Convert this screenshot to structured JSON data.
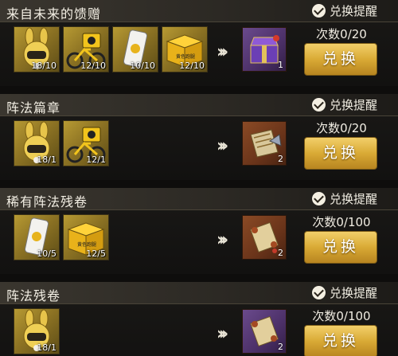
{
  "sections": [
    {
      "title": "来自未来的馈赠",
      "remind": "兑换提醒",
      "times": "次数0/20",
      "button": "兑换",
      "items": [
        {
          "icon": "rabbit-helmet-icon",
          "count": "18/10"
        },
        {
          "icon": "bicycle-icon",
          "count": "12/10"
        },
        {
          "icon": "phone-icon",
          "count": "10/10"
        },
        {
          "icon": "gold-box-icon",
          "count": "12/10"
        }
      ],
      "reward": {
        "icon": "treasure-chest-icon",
        "count": "1"
      }
    },
    {
      "title": "阵法篇章",
      "remind": "兑换提醒",
      "times": "次数0/20",
      "button": "兑换",
      "items": [
        {
          "icon": "rabbit-helmet-icon",
          "count": "18/1"
        },
        {
          "icon": "bicycle-icon",
          "count": "12/1"
        }
      ],
      "reward": {
        "icon": "scroll-map-icon",
        "count": "2"
      }
    },
    {
      "title": "稀有阵法残卷",
      "remind": "兑换提醒",
      "times": "次数0/100",
      "button": "兑换",
      "items": [
        {
          "icon": "phone-icon",
          "count": "10/5"
        },
        {
          "icon": "gold-box-icon",
          "count": "12/5"
        }
      ],
      "reward": {
        "icon": "ancient-scroll-icon",
        "count": "2"
      }
    },
    {
      "title": "阵法残卷",
      "remind": "兑换提醒",
      "times": "次数0/100",
      "button": "兑换",
      "items": [
        {
          "icon": "rabbit-helmet-icon",
          "count": "18/1"
        }
      ],
      "reward": {
        "icon": "ancient-scroll-icon",
        "count": "2"
      }
    }
  ],
  "gold_box_label": "黄色跑腿",
  "colors": {
    "accent": "#d9aa35",
    "item_bg": "#8e7424",
    "reward_bg": "#6a341a"
  }
}
